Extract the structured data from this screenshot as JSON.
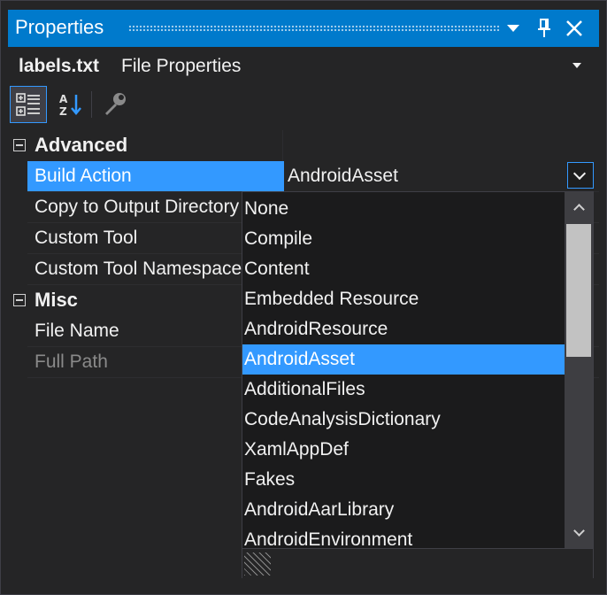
{
  "window": {
    "title": "Properties",
    "buttons": [
      {
        "name": "dropdown-arrow-icon"
      },
      {
        "name": "pin-icon"
      },
      {
        "name": "close-icon"
      }
    ]
  },
  "object": {
    "name": "labels.txt",
    "type": "File Properties"
  },
  "toolbar": {
    "items": [
      "categorized-icon",
      "alphabetical-icon",
      "property-pages-icon"
    ]
  },
  "grid": {
    "categories": [
      {
        "label": "Advanced",
        "rows": [
          {
            "name": "Build Action",
            "value": "AndroidAsset",
            "selected": true
          },
          {
            "name": "Copy to Output Directory",
            "value": ""
          },
          {
            "name": "Custom Tool",
            "value": ""
          },
          {
            "name": "Custom Tool Namespace",
            "value": ""
          }
        ]
      },
      {
        "label": "Misc",
        "rows": [
          {
            "name": "File Name",
            "value": ""
          },
          {
            "name": "Full Path",
            "value": ""
          }
        ]
      }
    ]
  },
  "dropdown": {
    "selected": "AndroidAsset",
    "options": [
      "None",
      "Compile",
      "Content",
      "Embedded Resource",
      "AndroidResource",
      "AndroidAsset",
      "AdditionalFiles",
      "CodeAnalysisDictionary",
      "XamlAppDef",
      "Fakes",
      "AndroidAarLibrary",
      "AndroidEnvironment"
    ]
  },
  "colors": {
    "accent": "#007acc",
    "selection": "#3399ff",
    "background": "#252526",
    "text": "#f1f1f1"
  }
}
